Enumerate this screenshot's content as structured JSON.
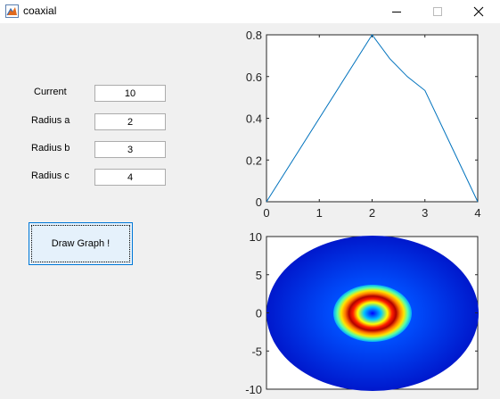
{
  "window": {
    "title": "coaxial",
    "app_icon": "matlab-figure-icon",
    "controls": [
      "minimize-icon",
      "maximize-icon",
      "close-icon"
    ]
  },
  "form": {
    "current_label": "Current",
    "current_value": "10",
    "radius_a_label": "Radius a",
    "radius_a_value": "2",
    "radius_b_label": "Radius b",
    "radius_b_value": "3",
    "radius_c_label": "Radius c",
    "radius_c_value": "4",
    "draw_button_label": "Draw Graph !"
  },
  "chart_data": [
    {
      "type": "line",
      "x": [
        0,
        2,
        2.333,
        2.667,
        3,
        4
      ],
      "y": [
        0,
        0.8,
        0.686,
        0.6,
        0.533,
        0
      ],
      "xticks": [
        "0",
        "1",
        "2",
        "3",
        "4"
      ],
      "yticks": [
        "0",
        "0.2",
        "0.4",
        "0.6",
        "0.8"
      ],
      "xlim": [
        0,
        4
      ],
      "ylim": [
        0,
        0.8
      ],
      "line_color": "#0072bd"
    },
    {
      "type": "heatmap",
      "colormap": "jet",
      "xlim": [
        -10,
        10
      ],
      "ylim": [
        -10,
        10
      ],
      "yticks": [
        "10",
        "5",
        "0",
        "-5",
        "-10"
      ]
    }
  ]
}
